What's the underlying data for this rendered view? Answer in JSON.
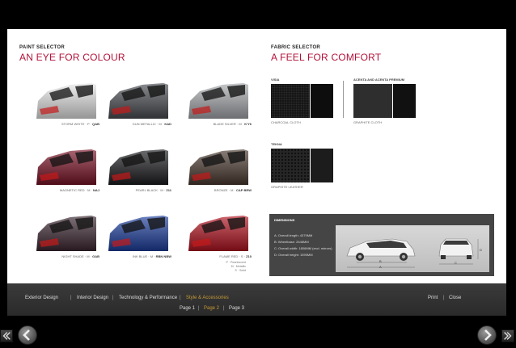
{
  "paint": {
    "label": "PAINT SELECTOR",
    "title": "AN EYE FOR COLOUR",
    "cars": [
      {
        "name": "STORM WHITE · P ·",
        "code": "QAB",
        "color": "#e6e6e6"
      },
      {
        "name": "GUN METALLIC · M ·",
        "code": "KAD",
        "color": "#4a4d52"
      },
      {
        "name": "BLADE SILVER · M ·",
        "code": "K'Y6",
        "color": "#a6a9ad"
      },
      {
        "name": "MAGNETIC RED · M ·",
        "code": "NAJ",
        "color": "#7a1226"
      },
      {
        "name": "PEARL BLACK · M ·",
        "code": "Z11",
        "color": "#1c1d20"
      },
      {
        "name": "BRONZE · M ·",
        "code": "CAP BRW",
        "color": "#4a3a30"
      },
      {
        "name": "NIGHT SHADE · M ·",
        "code": "GAB",
        "color": "#3b2630"
      },
      {
        "name": "INK BLUE · M ·",
        "code": "RBN NBW",
        "color": "#1d3f9e"
      },
      {
        "name": "FLAME RED · S ·",
        "code": "Z10",
        "color": "#b21220"
      }
    ],
    "notes": [
      "P · Pearlescent",
      "M · Metallic",
      "S · Solid"
    ]
  },
  "fabric": {
    "label": "FABRIC SELECTOR",
    "title": "A FEEL FOR COMFORT",
    "groups": [
      {
        "name": "VISIA",
        "caption": "CHARCOAL CLOTH"
      },
      {
        "name": "ACENTA AND ACENTA PREMIUM",
        "caption": "GRAPHITE CLOTH"
      },
      {
        "name": "TEKNA",
        "caption": "GRAPHITE LEATHER"
      }
    ]
  },
  "dimensions": {
    "heading": "DIMENSIONS",
    "lines": [
      "A: Overall length: 4379MM",
      "B: Wheelbase: 2646MM",
      "C: Overall width: 1806MM (excl. mirrors)",
      "D: Overall height: 1590MM"
    ],
    "markers": [
      "A",
      "B",
      "C",
      "D"
    ]
  },
  "nav": {
    "sections": [
      "Exterior Design",
      "Interior Design",
      "Technology & Performance",
      "Style & Accessories"
    ],
    "active_section": "Style & Accessories",
    "print": "Print",
    "close": "Close",
    "pages": [
      "Page 1",
      "Page 2",
      "Page 3"
    ],
    "active_page": "Page 2",
    "separator": "|"
  },
  "colors": {
    "accent": "#b3123a",
    "active_nav": "#c79a35"
  }
}
